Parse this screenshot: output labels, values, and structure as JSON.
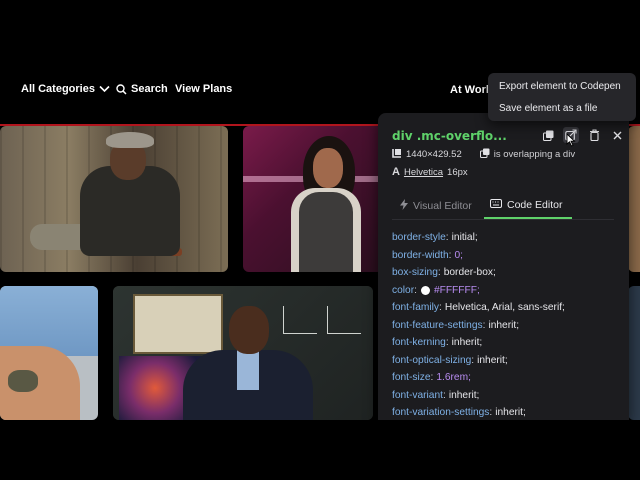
{
  "nav": {
    "categories_label": "All Categories",
    "search_label": "Search",
    "plans_label": "View Plans",
    "at_work_label": "At Work"
  },
  "menu": {
    "items": [
      {
        "label": "Export element to Codepen"
      },
      {
        "label": "Save element as a file"
      }
    ]
  },
  "inspector": {
    "title": "div .mc-overflo...",
    "dimensions": "1440×429.52",
    "overlap_note": "is overlapping a div",
    "font_name": "Helvetica",
    "font_size": "16px",
    "tabs": [
      {
        "label": "Visual Editor",
        "active": false
      },
      {
        "label": "Code Editor",
        "active": true
      }
    ],
    "css": [
      {
        "prop": "border-style",
        "value": "initial;"
      },
      {
        "prop": "border-width",
        "value": "0;",
        "purple": true
      },
      {
        "prop": "box-sizing",
        "value": "border-box;"
      },
      {
        "prop": "color",
        "value": "#FFFFFF;",
        "purple": true,
        "swatch": true
      },
      {
        "prop": "font-family",
        "value": "Helvetica, Arial, sans-serif;"
      },
      {
        "prop": "font-feature-settings",
        "value": "inherit;"
      },
      {
        "prop": "font-kerning",
        "value": "inherit;"
      },
      {
        "prop": "font-optical-sizing",
        "value": "inherit;"
      },
      {
        "prop": "font-size",
        "value": "1.6rem;",
        "purple": true
      },
      {
        "prop": "font-variant",
        "value": "inherit;"
      },
      {
        "prop": "font-variation-settings",
        "value": "inherit;"
      }
    ]
  },
  "colors": {
    "accent_green": "#5fd26a",
    "css_prop_blue": "#7fb1e6",
    "css_value_purple": "#b78cf0",
    "brand_red": "#b1151d"
  }
}
